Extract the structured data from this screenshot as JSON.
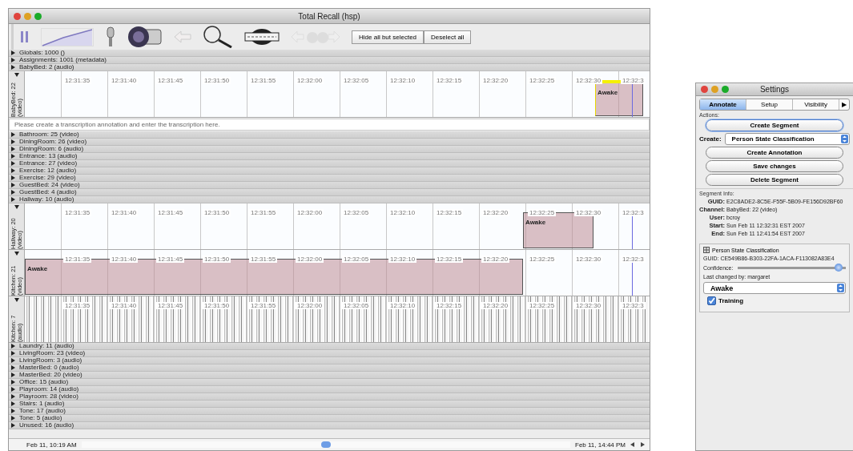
{
  "main_window": {
    "title": "Total Recall (hsp)",
    "toolbar": {
      "buttons": [
        "Hide all but selected",
        "Deselect all"
      ]
    },
    "channels": [
      {
        "kind": "channel",
        "name": "Globals: 1000 ()",
        "expanded": false
      },
      {
        "kind": "channel",
        "name": "Assignments: 1001 (metadata)",
        "expanded": false
      },
      {
        "kind": "channel",
        "name": "BabyBed: 2 (audio)",
        "expanded": false
      },
      {
        "kind": "channel",
        "name": "BabyBed: 22 (video)",
        "expanded": true,
        "track": {
          "kind": "video",
          "ticks": [
            "12:31:35",
            "12:31:40",
            "12:31:45",
            "12:31:50",
            "12:31:55",
            "12:32:00",
            "12:32:05",
            "12:32:10",
            "12:32:15",
            "12:32:20",
            "12:32:25",
            "12:32:30",
            "12:32:3"
          ],
          "segment": {
            "label": "Awake",
            "selected": true
          }
        }
      },
      {
        "kind": "transcription",
        "placeholder": "Please create a transcription annotation and enter the transcription here."
      },
      {
        "kind": "channel",
        "name": "Bathroom: 25 (video)",
        "expanded": false
      },
      {
        "kind": "channel",
        "name": "DiningRoom: 26 (video)",
        "expanded": false
      },
      {
        "kind": "channel",
        "name": "DiningRoom: 6 (audio)",
        "expanded": false
      },
      {
        "kind": "channel",
        "name": "Entrance: 13 (audio)",
        "expanded": false
      },
      {
        "kind": "channel",
        "name": "Entrance: 27 (video)",
        "expanded": false
      },
      {
        "kind": "channel",
        "name": "Exercise: 12 (audio)",
        "expanded": false
      },
      {
        "kind": "channel",
        "name": "Exercise: 29 (video)",
        "expanded": false
      },
      {
        "kind": "channel",
        "name": "GuestBed: 24 (video)",
        "expanded": false
      },
      {
        "kind": "channel",
        "name": "GuestBed: 4 (audio)",
        "expanded": false
      },
      {
        "kind": "channel",
        "name": "Hallway: 10 (audio)",
        "expanded": false
      },
      {
        "kind": "channel",
        "name": "Hallway: 20 (video)",
        "expanded": true,
        "track": {
          "kind": "video",
          "ticks": [
            "12:31:35",
            "12:31:40",
            "12:31:45",
            "12:31:50",
            "12:31:55",
            "12:32:00",
            "12:32:05",
            "12:32:10",
            "12:32:15",
            "12:32:20",
            "12:32:25",
            "12:32:30",
            "12:32:3"
          ],
          "segment": {
            "label": "Awake",
            "selected": false
          }
        }
      },
      {
        "kind": "channel",
        "name": "Kitchen: 21 (video)",
        "expanded": true,
        "track": {
          "kind": "video",
          "ticks": [
            "12:31:35",
            "12:31:40",
            "12:31:45",
            "12:31:50",
            "12:31:55",
            "12:32:00",
            "12:32:05",
            "12:32:10",
            "12:32:15",
            "12:32:20",
            "12:32:25",
            "12:32:30",
            "12:32:3"
          ],
          "segment": {
            "label": "Awake",
            "selected": false
          }
        }
      },
      {
        "kind": "channel",
        "name": "Kitchen: 7 (audio)",
        "expanded": true,
        "track": {
          "kind": "audio",
          "ticks": [
            "12:31:35",
            "12:31:40",
            "12:31:45",
            "12:31:50",
            "12:31:55",
            "12:32:00",
            "12:32:05",
            "12:32:10",
            "12:32:15",
            "12:32:20",
            "12:32:25",
            "12:32:30",
            "12:32:3"
          ]
        }
      },
      {
        "kind": "channel",
        "name": "Laundry: 11 (audio)",
        "expanded": false
      },
      {
        "kind": "channel",
        "name": "LivingRoom: 23 (video)",
        "expanded": false
      },
      {
        "kind": "channel",
        "name": "LivingRoom: 3 (audio)",
        "expanded": false
      },
      {
        "kind": "channel",
        "name": "MasterBed: 0 (audio)",
        "expanded": false
      },
      {
        "kind": "channel",
        "name": "MasterBed: 20 (video)",
        "expanded": false
      },
      {
        "kind": "channel",
        "name": "Office: 15 (audio)",
        "expanded": false
      },
      {
        "kind": "channel",
        "name": "Playroom: 14 (audio)",
        "expanded": false
      },
      {
        "kind": "channel",
        "name": "Playroom: 28 (video)",
        "expanded": false
      },
      {
        "kind": "channel",
        "name": "Stairs: 1 (audio)",
        "expanded": false
      },
      {
        "kind": "channel",
        "name": "Tone: 17 (audio)",
        "expanded": false
      },
      {
        "kind": "channel",
        "name": "Tone: 5 (audio)",
        "expanded": false
      },
      {
        "kind": "channel",
        "name": "Unused: 16 (audio)",
        "expanded": false
      }
    ],
    "status_bar": {
      "start": "Feb 11, 10:19 AM",
      "end": "Feb 11, 14:44 PM"
    }
  },
  "settings": {
    "title": "Settings",
    "tabs": [
      {
        "label": "Annotate",
        "selected": true
      },
      {
        "label": "Setup",
        "selected": false
      },
      {
        "label": "Visibility",
        "selected": false
      }
    ],
    "more_tabs": "▶",
    "actions": {
      "heading": "Actions:",
      "create_segment": "Create Segment",
      "create_label": "Create:",
      "create_type": "Person State Classification",
      "buttons": [
        "Create Annotation",
        "Save changes",
        "Delete Segment"
      ]
    },
    "segment_info": {
      "heading": "Segment Info:",
      "fields": [
        {
          "label": "GUID:",
          "value": "E2C8ADE2-8C5E-F55F-5B09-FE156D92BF60"
        },
        {
          "label": "Channel:",
          "value": "BabyBed: 22 (video)"
        },
        {
          "label": "User:",
          "value": "bcroy"
        },
        {
          "label": "Start:",
          "value": "Sun Feb 11 12:32:31 EST 2007"
        },
        {
          "label": "End:",
          "value": "Sun Feb 11 12:41:54 EST 2007"
        }
      ]
    },
    "classification": {
      "title": "Person State Classification",
      "guid": "GUID: CE549B86-B303-22FA-1ACA-F113082A83E4",
      "confidence_label": "Confidence:",
      "confidence": {
        "level": 0.97
      },
      "last_changed": "Last changed by: margaret",
      "state": "Awake",
      "training": {
        "label": "Training",
        "checked": true
      }
    }
  }
}
